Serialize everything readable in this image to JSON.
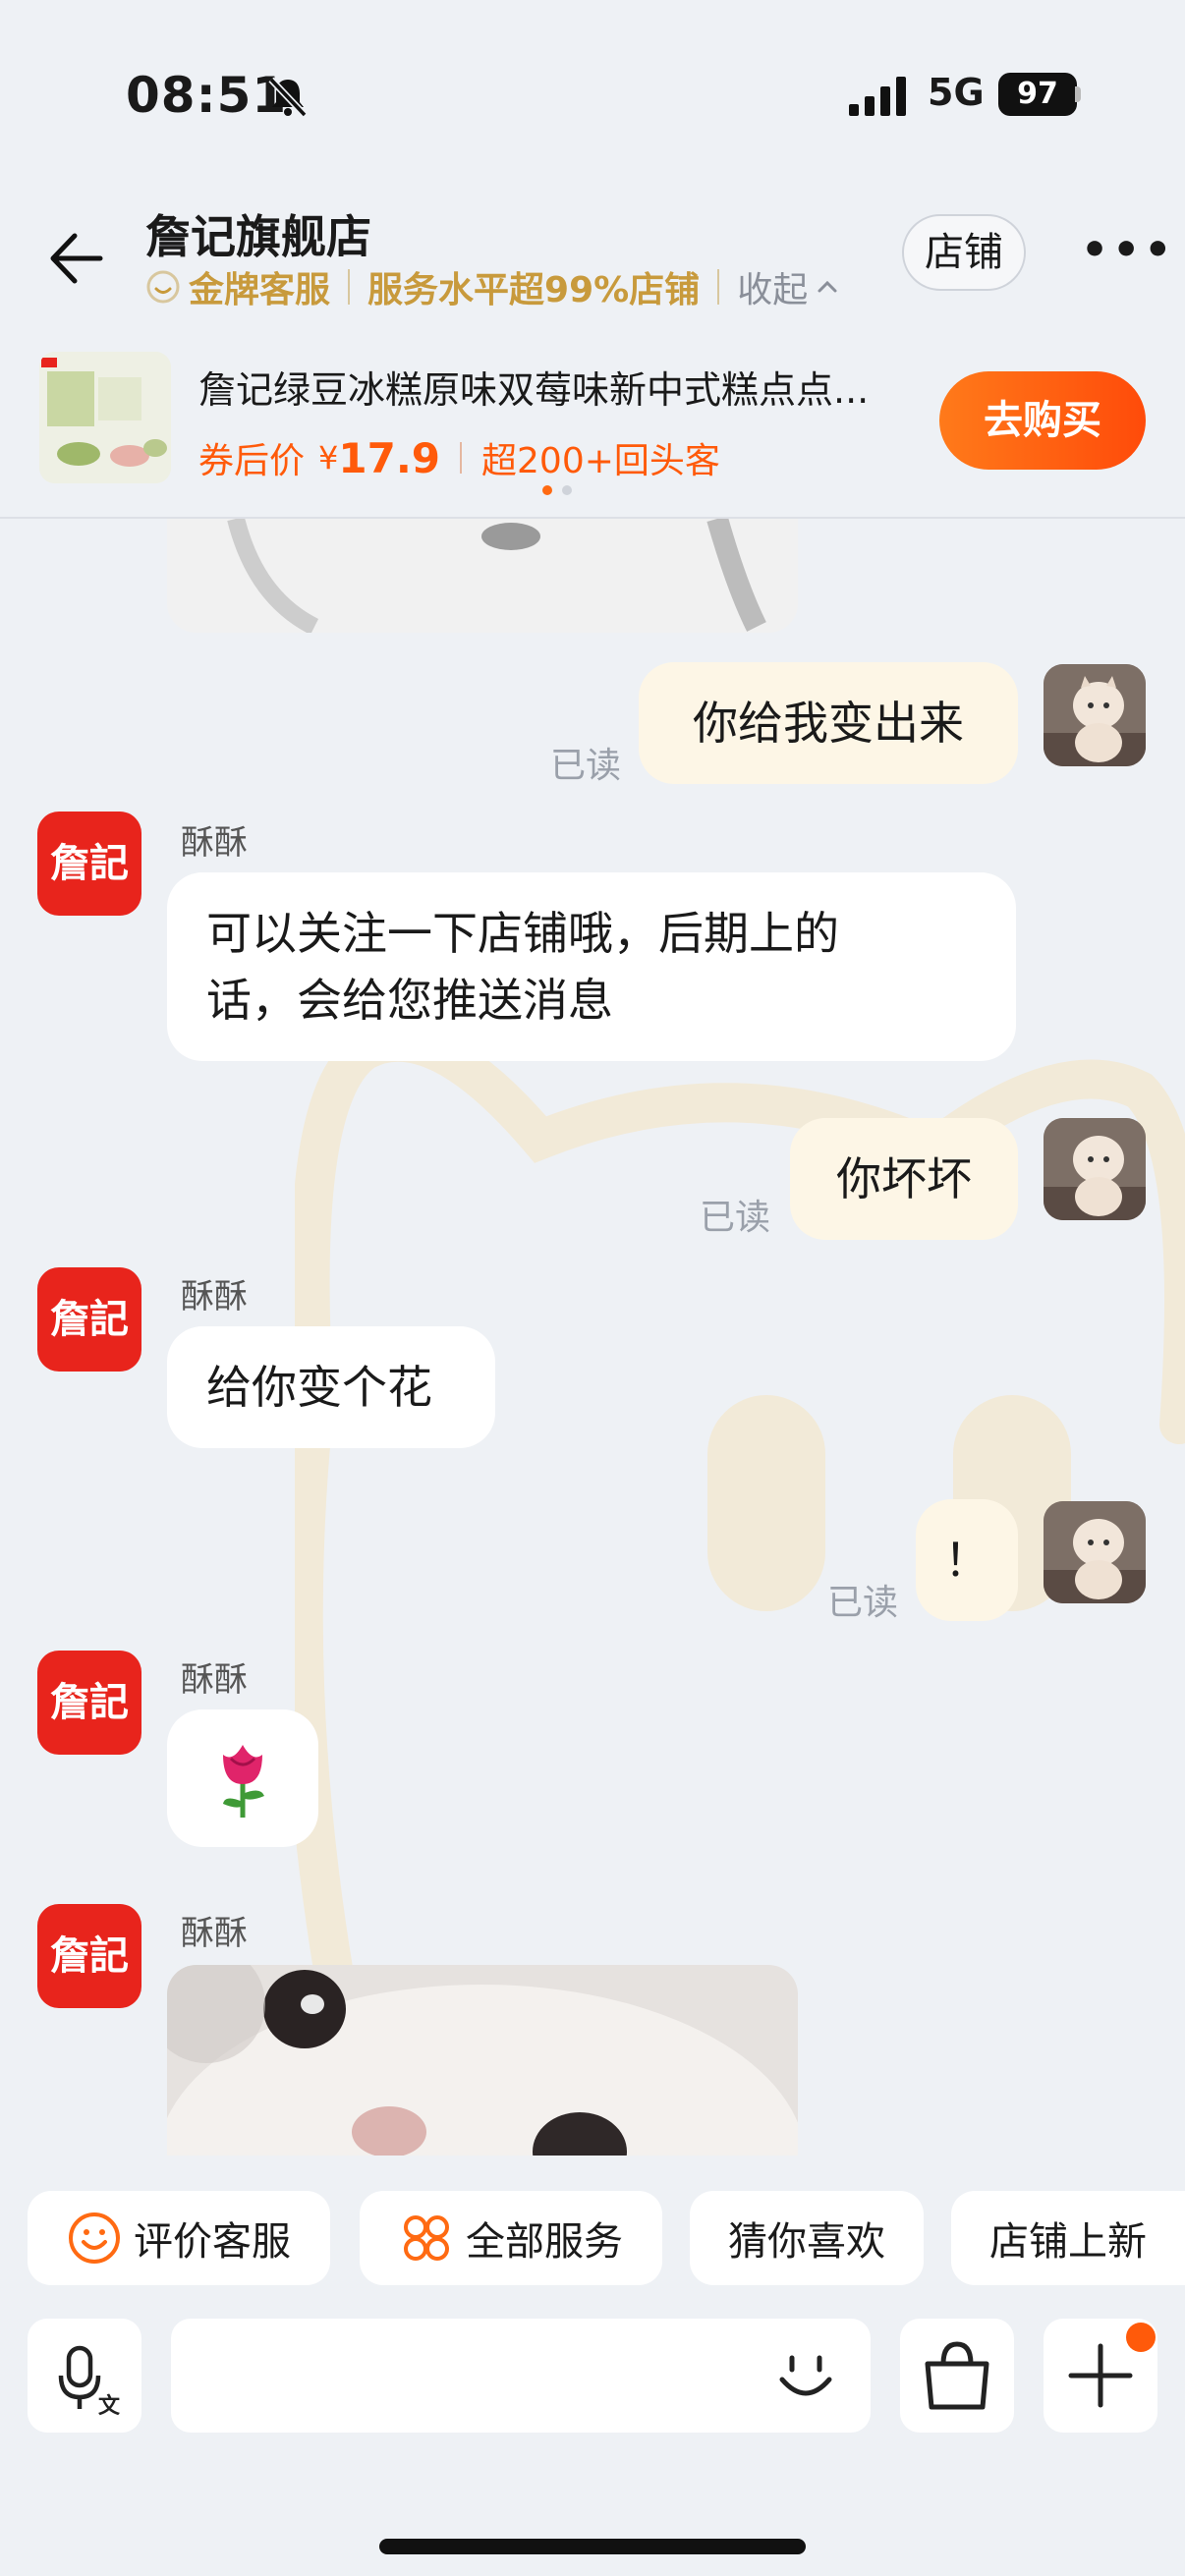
{
  "status_bar": {
    "time": "08:51",
    "network": "5G",
    "battery": "97"
  },
  "header": {
    "title": "詹记旗舰店",
    "service_badge": "金牌客服",
    "service_level": "服务水平超99%店铺",
    "collapse_label": "收起",
    "store_button": "店铺",
    "more_icon": "more-icon"
  },
  "product": {
    "name": "詹记绿豆冰糕原味双莓味新中式糕点点...",
    "price_prefix": "券后价",
    "currency": "¥",
    "price": "17.9",
    "repeat": "超200+回头客",
    "buy_label": "去购买",
    "dots_total": 2,
    "dots_active": 1
  },
  "chat": {
    "agent_name": "酥酥",
    "logo_text": "詹記",
    "read_label": "已读",
    "messages": [
      {
        "from": "me",
        "text": "你给我变出来"
      },
      {
        "from": "agent",
        "text_line1": "可以关注一下店铺哦，后期上的",
        "text_line2": "话，会给您推送消息"
      },
      {
        "from": "me",
        "text": "你坏坏"
      },
      {
        "from": "agent",
        "text": "给你变个花"
      },
      {
        "from": "me",
        "text": "！"
      },
      {
        "from": "agent",
        "emoji": "🌹"
      },
      {
        "from": "agent",
        "image": "cat-photo"
      }
    ]
  },
  "quick_actions": {
    "rate": "评价客服",
    "all_services": "全部服务",
    "guess": "猜你喜欢",
    "new": "店铺上新"
  },
  "colors": {
    "accent": "#ff5a0a",
    "gold": "#c89a3c",
    "brand_red": "#e8241c",
    "out_bubble": "#fdf6e6"
  }
}
